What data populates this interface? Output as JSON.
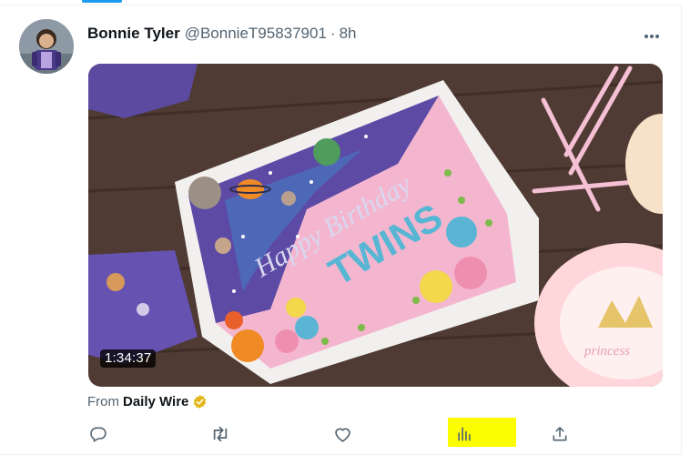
{
  "post": {
    "author": {
      "display_name": "Bonnie Tyler",
      "handle": "@BonnieT95837901",
      "separator": "·",
      "time": "8h"
    },
    "media": {
      "type": "video",
      "duration": "1:34:37",
      "cake_text_line1": "Happy Birthday",
      "cake_text_line2": "TWINS",
      "plate_text": "princess"
    },
    "source": {
      "prefix": "From",
      "name": "Daily Wire",
      "verified": true
    },
    "actions": [
      {
        "name": "reply",
        "icon": "speech-bubble-icon"
      },
      {
        "name": "repost",
        "icon": "repost-arrows-icon"
      },
      {
        "name": "like",
        "icon": "heart-icon"
      },
      {
        "name": "views",
        "icon": "bar-chart-icon",
        "highlighted": true
      },
      {
        "name": "share",
        "icon": "share-upload-icon"
      }
    ]
  },
  "colors": {
    "text_primary": "#0f1419",
    "text_secondary": "#536471",
    "accent": "#1d9bf0",
    "verified_badge": "#e2b719",
    "highlight": "#fcfc02"
  }
}
